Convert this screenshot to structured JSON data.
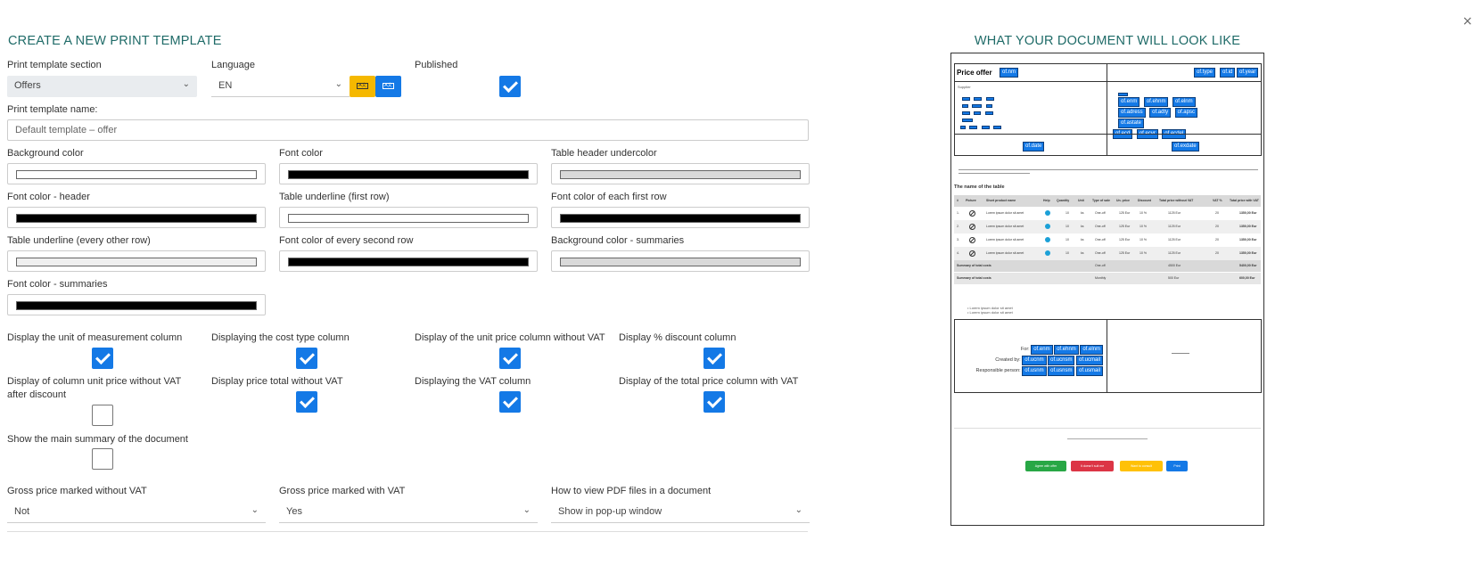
{
  "header": {
    "form_title": "CREATE A NEW PRINT TEMPLATE",
    "preview_title": "WHAT YOUR DOCUMENT WILL LOOK LIKE",
    "close_icon": "×"
  },
  "form": {
    "section": {
      "label": "Print template section",
      "value": "Offers"
    },
    "language": {
      "label": "Language",
      "value": "EN",
      "btn1_glyph": "A文",
      "btn2_glyph": "A文",
      "btn1_color": "#f5b800",
      "btn2_color": "#1479e6"
    },
    "published": {
      "label": "Published",
      "checked": true
    },
    "template_name": {
      "label": "Print template name:",
      "value": "Default template – offer"
    },
    "colors": [
      {
        "label": "Background color",
        "value": "#ffffff"
      },
      {
        "label": "Font color",
        "value": "#000000"
      },
      {
        "label": "Table header undercolor",
        "value": "#d9d9d9"
      },
      {
        "label": "Font color - header",
        "value": "#000000"
      },
      {
        "label": "Table underline (first row)",
        "value": "#ffffff"
      },
      {
        "label": "Font color of each first row",
        "value": "#000000"
      },
      {
        "label": "Table underline (every other row)",
        "value": "#efefef"
      },
      {
        "label": "Font color of every second row",
        "value": "#000000"
      },
      {
        "label": "Background color - summaries",
        "value": "#d9d9d9"
      },
      {
        "label": "Font color - summaries",
        "value": "#000000"
      }
    ],
    "options": [
      {
        "label": "Display the unit of measurement column",
        "checked": true
      },
      {
        "label": "Displaying the cost type column",
        "checked": true
      },
      {
        "label": "Display of the unit price column without VAT",
        "checked": true
      },
      {
        "label": "Display % discount column",
        "checked": true
      },
      {
        "label": "Display of column unit price without VAT after discount",
        "checked": false
      },
      {
        "label": "Display price total without VAT",
        "checked": true
      },
      {
        "label": "Displaying the VAT column",
        "checked": true
      },
      {
        "label": "Display of the total price column with VAT",
        "checked": true
      },
      {
        "label": "Show the main summary of the document",
        "checked": false
      }
    ],
    "selects": [
      {
        "label": "Gross price marked without VAT",
        "value": "Not"
      },
      {
        "label": "Gross price marked with VAT",
        "value": "Yes"
      },
      {
        "label": "How to view PDF files in a document",
        "value": "Show in pop-up window"
      }
    ],
    "accent_color": "#1479e6",
    "title_color": "#1f6b68"
  },
  "preview": {
    "title_left": "Price offer",
    "tag_nm": "of.nm",
    "tag_type": "of.type",
    "tag_id": "of.id",
    "tag_year": "of.year",
    "right_tags_row1": [
      "of.enm",
      "of.ehnm",
      "of.elnm"
    ],
    "right_tags_row2": [
      "of.adress",
      "of.adty",
      "of.apsc"
    ],
    "right_tags_row3": [
      "of.astate"
    ],
    "right_tags_row4": [
      "of.ecd",
      "of.ecvr",
      "of.ecdel"
    ],
    "tag_date": "of.date",
    "tag_validate": "of.exdate",
    "table_title": "The name of the table",
    "table_headers": [
      "#",
      "Picture",
      "Short product name",
      "Help",
      "Quantity",
      "Unit",
      "Type of sale",
      "Un. price",
      "Discount",
      "Total price without VAT",
      "VAT %",
      "Total price with VAT"
    ],
    "rows": [
      {
        "n": "1.",
        "name": "Lorem ipsum dolor sit amet",
        "qty": "10",
        "unit": "ks",
        "type": "One-off",
        "price": "125 Eur",
        "disc": "10 %",
        "total": "1125 Eur",
        "vat": "20",
        "gross": "1350,00 Eur"
      },
      {
        "n": "2.",
        "name": "Lorem ipsum dolor sit amet",
        "qty": "10",
        "unit": "ks",
        "type": "One-off",
        "price": "125 Eur",
        "disc": "10 %",
        "total": "1125 Eur",
        "vat": "20",
        "gross": "1350,00 Eur"
      },
      {
        "n": "3.",
        "name": "Lorem ipsum dolor sit amet",
        "qty": "10",
        "unit": "ks",
        "type": "One-off",
        "price": "125 Eur",
        "disc": "10 %",
        "total": "1125 Eur",
        "vat": "20",
        "gross": "1350,00 Eur"
      },
      {
        "n": "4.",
        "name": "Lorem ipsum dolor sit amet",
        "qty": "10",
        "unit": "ks",
        "type": "One-off",
        "price": "125 Eur",
        "disc": "10 %",
        "total": "1125 Eur",
        "vat": "20",
        "gross": "1350,00 Eur"
      }
    ],
    "summary1": {
      "label": "Summary of total costs",
      "type": "One-off",
      "total": "4500 Eur",
      "gross": "5400,00 Eur"
    },
    "summary2": {
      "label": "Summary of total costs",
      "type": "Monthly",
      "total": "500 Eur",
      "gross": "600,00 Eur"
    },
    "bullets": [
      "Lorem ipsum dolor sit amet",
      "Lorem ipsum dolor sit amet"
    ],
    "for_label": "For:",
    "for_tags": [
      "of.enm",
      "of.ehnm",
      "of.elnm"
    ],
    "created_label": "Created by:",
    "created_tags": [
      "of.ucnm",
      "of.ucnsm",
      "of.ucmail"
    ],
    "resp_label": "Responsible person:",
    "resp_tags": [
      "of.usnm",
      "of.usnsm",
      "of.usmail"
    ],
    "buttons": [
      {
        "label": "Agree with offer",
        "color": "#28a745"
      },
      {
        "label": "It doesn't suit me",
        "color": "#dc3545"
      },
      {
        "label": "Want to consult",
        "color": "#ffc107"
      },
      {
        "label": "Print",
        "color": "#1479e6"
      }
    ]
  }
}
